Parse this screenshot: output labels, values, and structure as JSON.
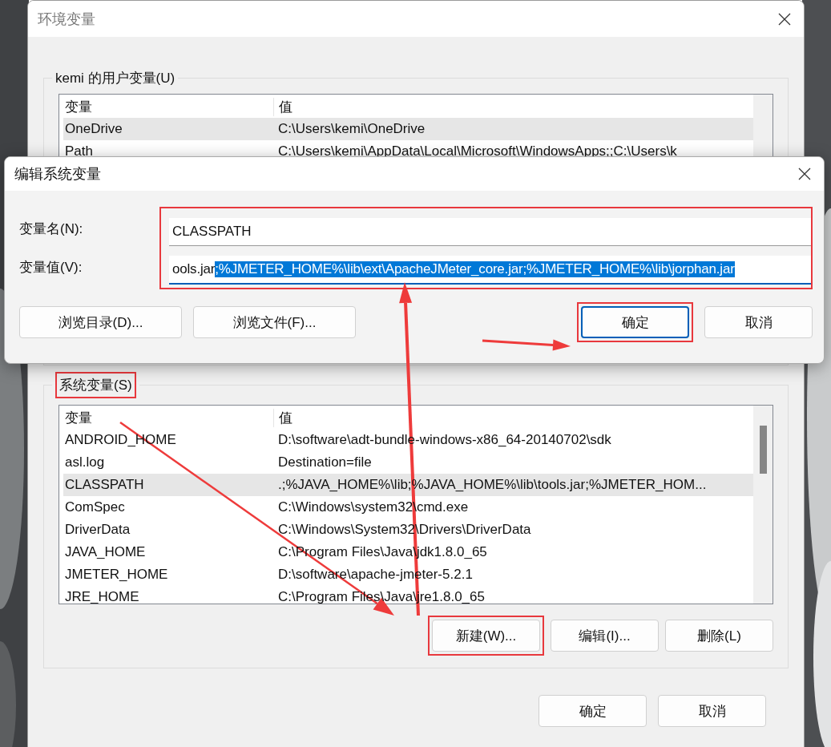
{
  "env_window": {
    "title": "环境变量",
    "user_group": {
      "label": "kemi 的用户变量(U)",
      "highlighted": false,
      "columns": [
        "变量",
        "值"
      ],
      "rows": [
        {
          "name": "OneDrive",
          "value": "C:\\Users\\kemi\\OneDrive",
          "selected": true
        },
        {
          "name": "Path",
          "value": "C:\\Users\\kemi\\AppData\\Local\\Microsoft\\WindowsApps;;C:\\Users\\k",
          "selected": false
        }
      ]
    },
    "system_group": {
      "label": "系统变量(S)",
      "highlighted": true,
      "columns": [
        "变量",
        "值"
      ],
      "rows": [
        {
          "name": "ANDROID_HOME",
          "value": "D:\\software\\adt-bundle-windows-x86_64-20140702\\sdk",
          "selected": false
        },
        {
          "name": "asl.log",
          "value": "Destination=file",
          "selected": false
        },
        {
          "name": "CLASSPATH",
          "value": ".;%JAVA_HOME%\\lib;%JAVA_HOME%\\lib\\tools.jar;%JMETER_HOM...",
          "selected": true
        },
        {
          "name": "ComSpec",
          "value": "C:\\Windows\\system32\\cmd.exe",
          "selected": false
        },
        {
          "name": "DriverData",
          "value": "C:\\Windows\\System32\\Drivers\\DriverData",
          "selected": false
        },
        {
          "name": "JAVA_HOME",
          "value": "C:\\Program Files\\Java\\jdk1.8.0_65",
          "selected": false
        },
        {
          "name": "JMETER_HOME",
          "value": "D:\\software\\apache-jmeter-5.2.1",
          "selected": false
        },
        {
          "name": "JRE_HOME",
          "value": "C:\\Program Files\\Java\\jre1.8.0_65",
          "selected": false
        }
      ],
      "buttons": [
        {
          "label": "新建(W)...",
          "highlighted": true
        },
        {
          "label": "编辑(I)...",
          "highlighted": false
        },
        {
          "label": "删除(L)",
          "highlighted": false
        }
      ]
    },
    "buttons": [
      {
        "label": "确定",
        "highlighted": false
      },
      {
        "label": "取消",
        "highlighted": false
      }
    ]
  },
  "edit_dialog": {
    "title": "编辑系统变量",
    "fields_highlighted": true,
    "fields": [
      {
        "label": "变量名(N):",
        "value": "CLASSPATH"
      },
      {
        "label": "变量值(V):",
        "value": "ools.jar",
        "selected_text": ";%JMETER_HOME%\\lib\\ext\\ApacheJMeter_core.jar;%JMETER_HOME%\\lib\\jorphan.jar"
      }
    ],
    "buttons": [
      {
        "label": "浏览目录(D)...",
        "focused": false,
        "highlighted": false
      },
      {
        "label": "浏览文件(F)...",
        "focused": false,
        "highlighted": false
      },
      {
        "label": "确定",
        "focused": true,
        "highlighted": true
      },
      {
        "label": "取消",
        "focused": false,
        "highlighted": false
      }
    ]
  }
}
